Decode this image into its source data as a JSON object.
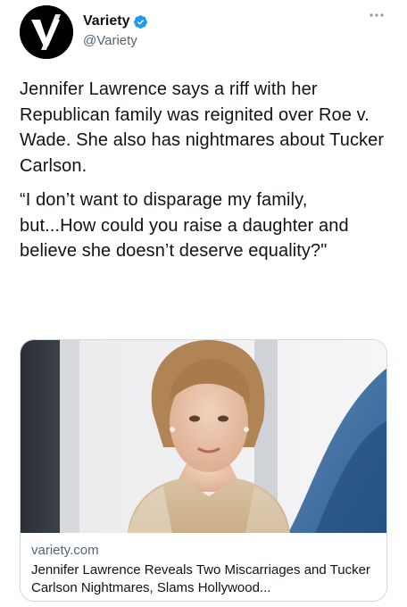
{
  "author": {
    "display_name": "Variety",
    "handle": "@Variety",
    "verified": true,
    "avatar_icon": "variety-logo-icon"
  },
  "tweet": {
    "paragraphs": [
      "Jennifer Lawrence says a riff with her Republican family was reignited over Roe v. Wade. She also has nightmares about Tucker Carlson.",
      "“I don’t want to disparage my family, but...How could you raise a daughter and believe she doesn’t deserve equality?\""
    ]
  },
  "link_card": {
    "domain": "variety.com",
    "title": "Jennifer Lawrence Reveals Two Miscarriages and Tucker Carlson Nightmares, Slams Hollywood..."
  },
  "colors": {
    "verified_blue": "#1d9bf0",
    "secondary_text": "#536471",
    "border": "#cfd9de"
  }
}
